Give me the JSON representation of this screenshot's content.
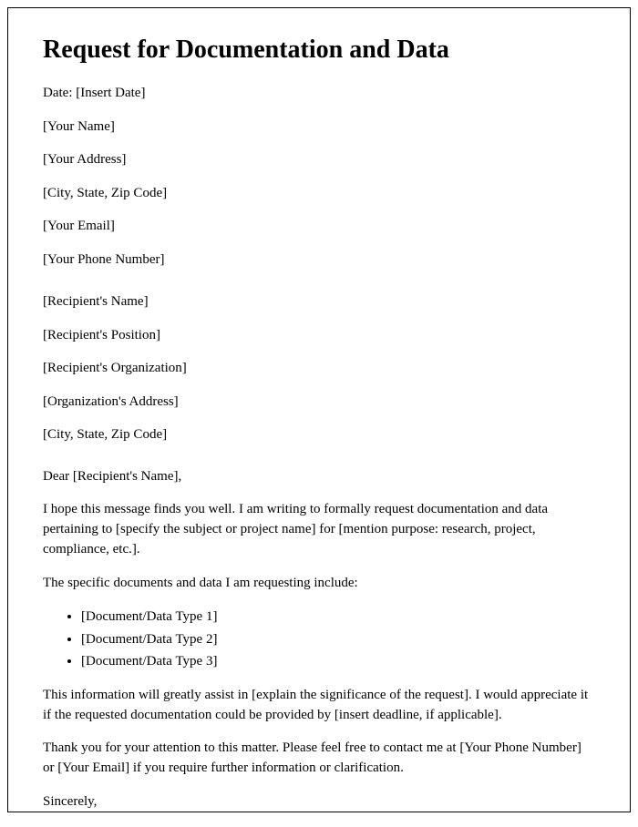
{
  "title": "Request for Documentation and Data",
  "sender": {
    "date": "Date: [Insert Date]",
    "name": "[Your Name]",
    "address": "[Your Address]",
    "citystatezip": "[City, State, Zip Code]",
    "email": "[Your Email]",
    "phone": "[Your Phone Number]"
  },
  "recipient": {
    "name": "[Recipient's Name]",
    "position": "[Recipient's Position]",
    "organization": "[Recipient's Organization]",
    "address": "[Organization's Address]",
    "citystatezip": "[City, State, Zip Code]"
  },
  "salutation": "Dear [Recipient's Name],",
  "body": {
    "para1": "I hope this message finds you well. I am writing to formally request documentation and data pertaining to [specify the subject or project name] for [mention purpose: research, project, compliance, etc.].",
    "list_intro": "The specific documents and data I am requesting include:",
    "items": [
      "[Document/Data Type 1]",
      "[Document/Data Type 2]",
      "[Document/Data Type 3]"
    ],
    "para2": "This information will greatly assist in [explain the significance of the request]. I would appreciate it if the requested documentation could be provided by [insert deadline, if applicable].",
    "para3": "Thank you for your attention to this matter. Please feel free to contact me at [Your Phone Number] or [Your Email] if you require further information or clarification.",
    "closing": "Sincerely,"
  }
}
